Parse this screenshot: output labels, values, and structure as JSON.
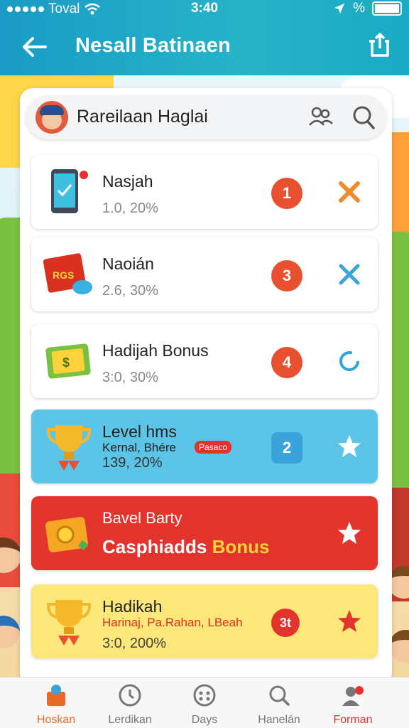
{
  "status_bar": {
    "carrier": "Toval",
    "time": "3:40",
    "battery_text": ""
  },
  "header": {
    "title": "Nesall Batinaen"
  },
  "search": {
    "title": "Rareilaan Haglai"
  },
  "rows": [
    {
      "label": "Nasjah",
      "sub": "1.0, 20%",
      "badge": "1",
      "thumb": "phone-icon",
      "action": "x-ribbon-icon"
    },
    {
      "label": "Naoián",
      "sub": "2.6, 30%",
      "badge": "3",
      "thumb": "red-box-icon",
      "thumb_text": "RGS",
      "action": "x-ribbon-icon"
    },
    {
      "label": "Hadijah Bonus",
      "sub": "3:0, 30%",
      "badge": "4",
      "thumb": "money-icon",
      "action": "refresh-icon"
    },
    {
      "label": "Level hms",
      "label2": "Kernal, Bhére",
      "tag": "Pasaco",
      "sub": "139, 20%",
      "badge": "2",
      "thumb": "trophy-icon",
      "action": "star-icon"
    },
    {
      "label": "Bavel Barty",
      "label2a": "Casphiadds",
      "label2b": "Bonus",
      "thumb": "treasure-icon",
      "action": "star-icon"
    },
    {
      "label": "Hadikah",
      "label2": "Harinaj, Pa.Rahan, LBeah",
      "sub": "3:0, 200%",
      "badge": "3t",
      "thumb": "trophy-icon",
      "action": "star-icon"
    }
  ],
  "nav": [
    {
      "label": "Hoskan",
      "icon": "home-icon"
    },
    {
      "label": "Lerdikan",
      "icon": "clock-icon"
    },
    {
      "label": "Days",
      "icon": "gamepad-icon"
    },
    {
      "label": "Hanelán",
      "icon": "search-icon"
    },
    {
      "label": "Forman",
      "icon": "profile-icon"
    }
  ],
  "colors": {
    "header": "#1a9cc6",
    "accent": "#e8502f",
    "active_nav": "#e86b25"
  }
}
